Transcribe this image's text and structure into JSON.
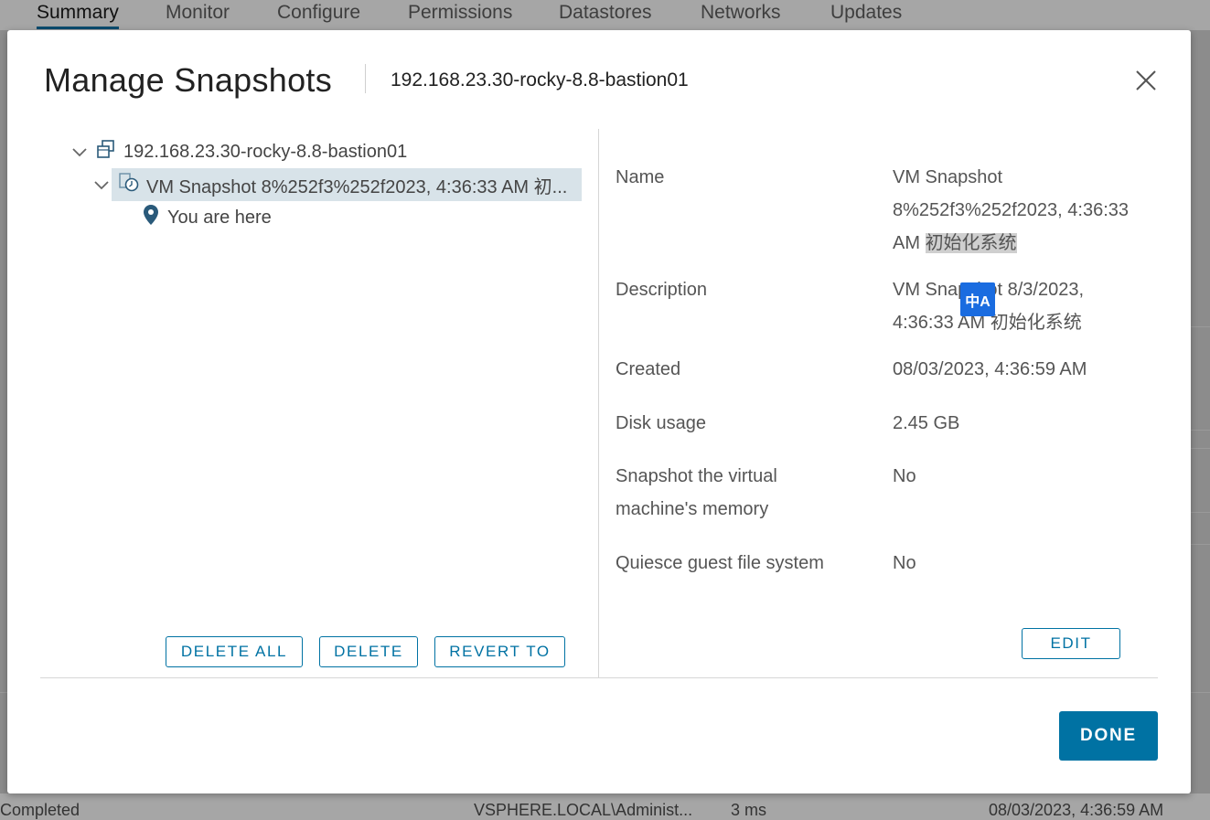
{
  "background": {
    "tabs": [
      "Summary",
      "Monitor",
      "Configure",
      "Permissions",
      "Datastores",
      "Networks",
      "Updates"
    ],
    "bottom_row": {
      "status": "Completed",
      "initiator": "VSPHERE.LOCAL\\Administ...",
      "duration": "3 ms",
      "time": "08/03/2023, 4:36:59 AM"
    }
  },
  "dialog": {
    "title": "Manage Snapshots",
    "vm_name": "192.168.23.30-rocky-8.8-bastion01",
    "close_icon": "close-icon"
  },
  "tree": {
    "root_label": "192.168.23.30-rocky-8.8-bastion01",
    "snapshot_label": "VM Snapshot 8%252f3%252f2023, 4:36:33 AM 初...",
    "you_are_here_label": "You are here"
  },
  "left_actions": {
    "delete_all": "DELETE ALL",
    "delete": "DELETE",
    "revert_to": "REVERT TO"
  },
  "details": {
    "name_label": "Name",
    "name_line1": "VM Snapshot",
    "name_line2": "8%252f3%252f2023, 4:36:33",
    "name_line3a": "AM",
    "name_line3b": "初始化系统",
    "description_label": "Description",
    "description_line1": "VM Snapshot 8/3/2023,",
    "description_line2": "4:36:33 AM 初始化系统",
    "created_label": "Created",
    "created_value": "08/03/2023, 4:36:59 AM",
    "disk_usage_label": "Disk usage",
    "disk_usage_value": "2.45 GB",
    "memory_label_line1": "Snapshot the virtual",
    "memory_label_line2": "machine's memory",
    "memory_value": "No",
    "quiesce_label": "Quiesce guest file system",
    "quiesce_value": "No",
    "edit_label": "EDIT",
    "translate_badge": "中A"
  },
  "footer": {
    "done_label": "DONE"
  },
  "colors": {
    "accent": "#0072a3",
    "selection": "#d8e3e9",
    "overlay": "#8c8c8c"
  }
}
